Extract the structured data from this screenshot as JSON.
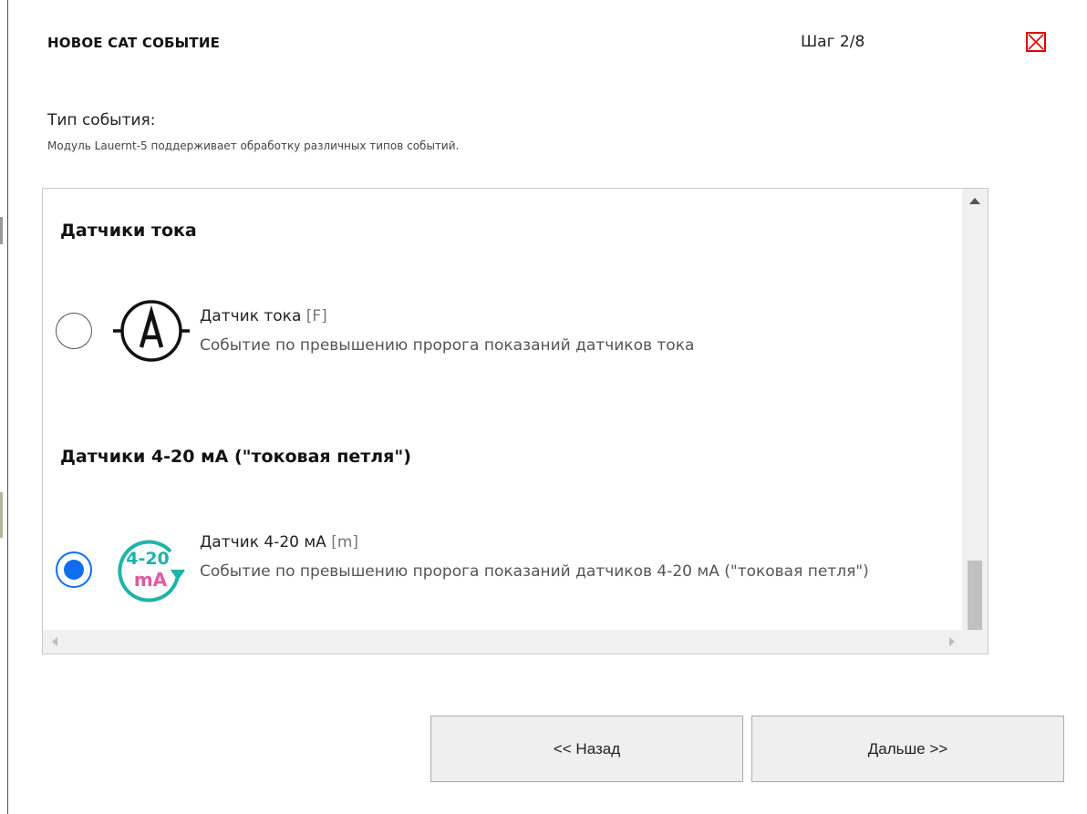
{
  "dialog": {
    "title": "НОВОЕ CAT СОБЫТИЕ",
    "step": "Шаг 2/8",
    "close_icon": "close-x-icon",
    "accent_color": "#e00000"
  },
  "section": {
    "label": "Тип события:",
    "description": "Модуль Lauernt-5 поддерживает обработку различных типов событий."
  },
  "event_list": {
    "groups": [
      {
        "heading": "Датчики тока",
        "items": [
          {
            "title": "Датчик тока",
            "code": "[F]",
            "description": "Событие по превышению пророга показаний датчиков тока",
            "icon": "ammeter-icon",
            "selected": false
          }
        ]
      },
      {
        "heading": "Датчики 4-20 мА (\"токовая петля\")",
        "items": [
          {
            "title": "Датчик 4-20 мА",
            "code": "[m]",
            "description": "Событие по превышению пророга показаний датчиков 4-20 мА (\"токовая петля\")",
            "icon": "current-loop-4-20ma-icon",
            "icon_text_top": "4-20",
            "icon_text_bottom": "mA",
            "icon_color": "#1fb3a8",
            "selected": true
          }
        ]
      }
    ],
    "radio_color": "#0f6ef0"
  },
  "buttons": {
    "back_label": "<< Назад",
    "next_label": "Дальше >>"
  }
}
